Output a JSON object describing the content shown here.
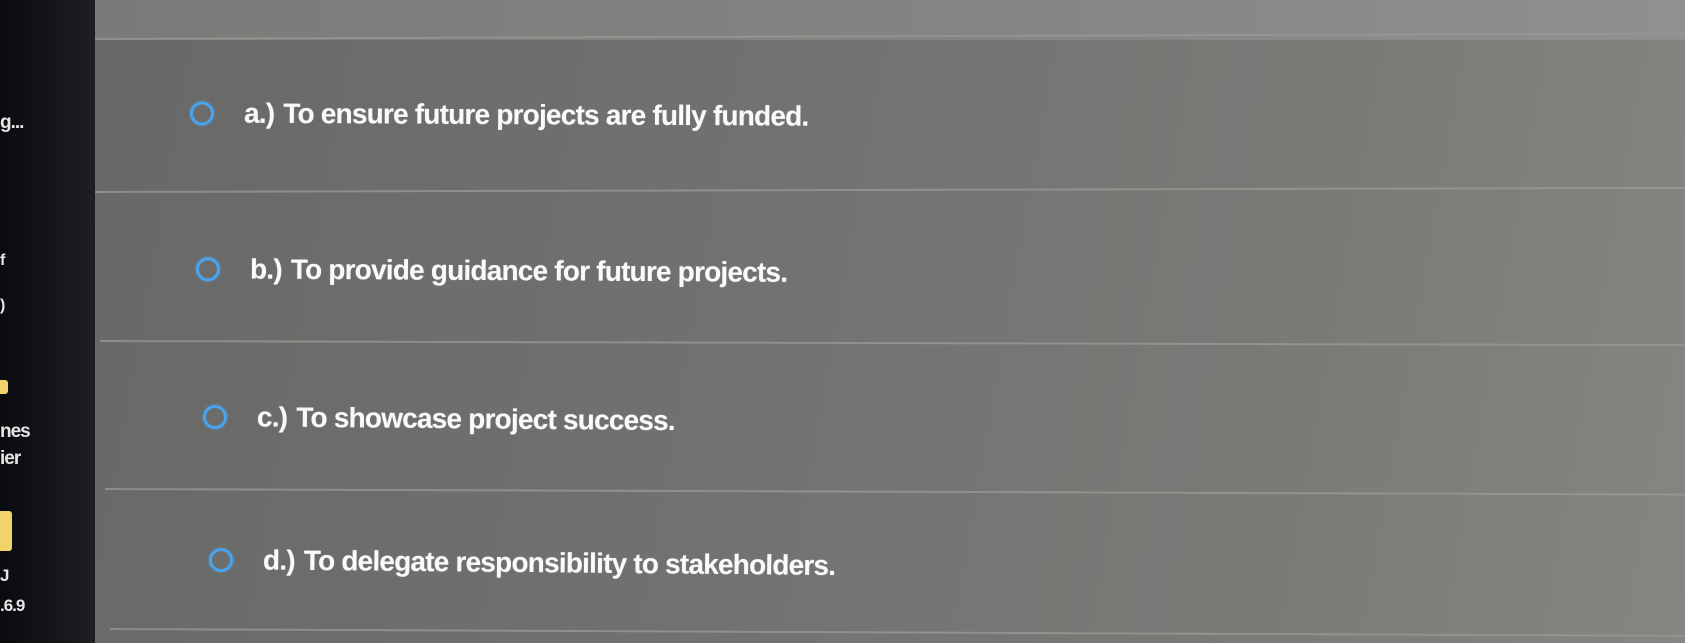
{
  "sidebar": {
    "fragments": [
      "g...",
      "f",
      ")",
      "nes",
      "ier",
      "J",
      ".6.9"
    ]
  },
  "question": {
    "options": [
      {
        "letter": "a.)",
        "text": "To ensure future projects are fully funded."
      },
      {
        "letter": "b.)",
        "text": "To provide guidance for future projects."
      },
      {
        "letter": "c.)",
        "text": "To showcase project success."
      },
      {
        "letter": "d.)",
        "text": "To delegate responsibility to stakeholders."
      }
    ]
  },
  "colors": {
    "radio_border": "#48a4ee",
    "option_text": "#fafafa",
    "panel_background": "#6d6d69"
  }
}
